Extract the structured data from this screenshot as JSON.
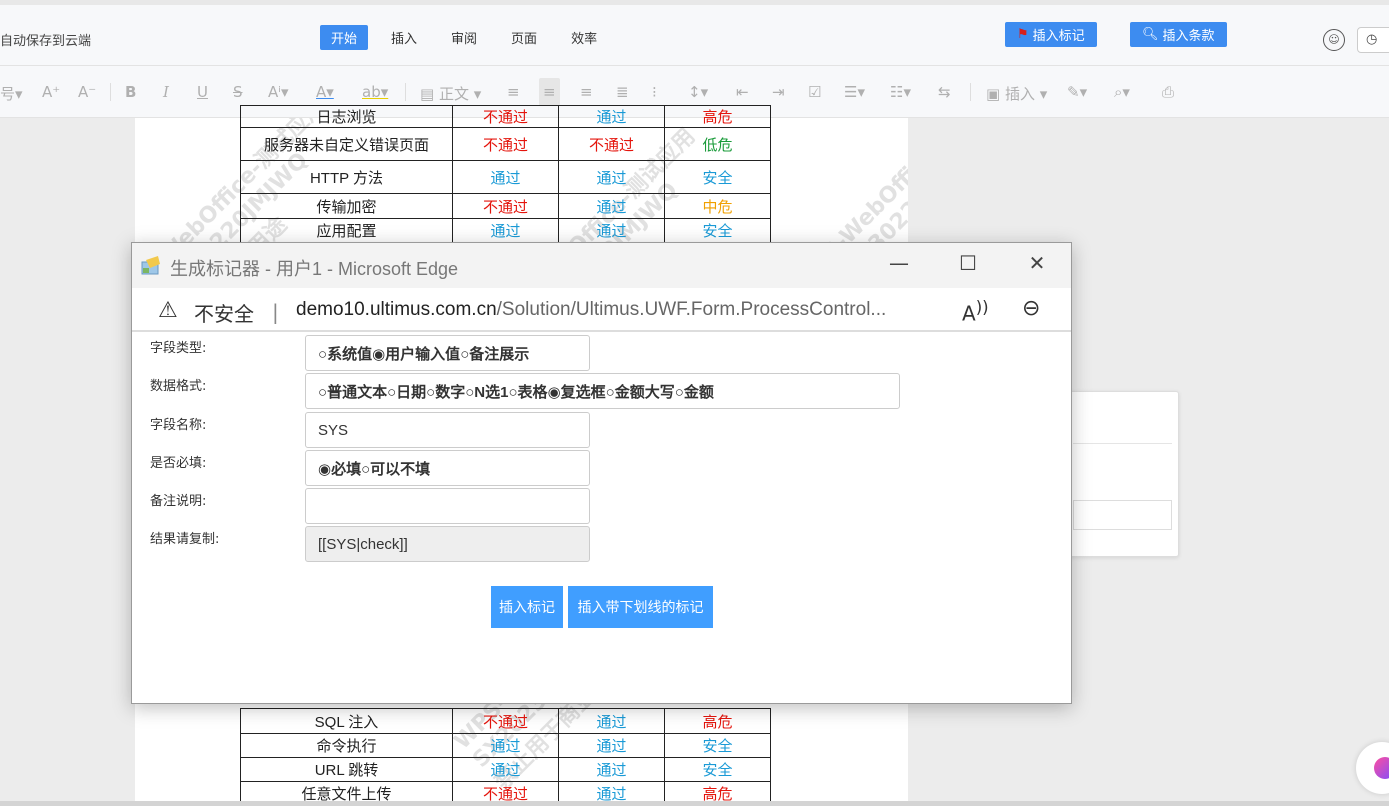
{
  "header": {
    "autosave": "自动保存到云端",
    "tabs": [
      {
        "label": "开始",
        "active": true
      },
      {
        "label": "插入",
        "active": false
      },
      {
        "label": "审阅",
        "active": false
      },
      {
        "label": "页面",
        "active": false
      },
      {
        "label": "效率",
        "active": false
      }
    ],
    "insert_mark_label": "插入标记",
    "insert_clause_label": "插入条款",
    "accent_color": "#3d8cf0"
  },
  "toolbar": {
    "style_label": "正文",
    "insert_label": "插入"
  },
  "watermark": {
    "line1": "WPS-WebOffice-测试应用",
    "line2": "SX20230220JMJWQ",
    "line3": "禁止用于商业用途"
  },
  "doc_table_top": [
    {
      "name": "日志浏览",
      "c1": "不通过",
      "c2": "通过",
      "c3": "高危",
      "k1": "red",
      "k2": "blue",
      "k3": "red"
    },
    {
      "name": "服务器未自定义错误页面",
      "c1": "不通过",
      "c2": "不通过",
      "c3": "低危",
      "k1": "red",
      "k2": "red",
      "k3": "green"
    },
    {
      "name": "HTTP 方法",
      "c1": "通过",
      "c2": "通过",
      "c3": "安全",
      "k1": "blue",
      "k2": "blue",
      "k3": "blue"
    },
    {
      "name": "传输加密",
      "c1": "不通过",
      "c2": "通过",
      "c3": "中危",
      "k1": "red",
      "k2": "blue",
      "k3": "orange"
    },
    {
      "name": "应用配置",
      "c1": "通过",
      "c2": "通过",
      "c3": "安全",
      "k1": "blue",
      "k2": "blue",
      "k3": "blue"
    }
  ],
  "doc_table_bottom": [
    {
      "name": "SQL 注入",
      "c1": "不通过",
      "c2": "通过",
      "c3": "高危",
      "k1": "red",
      "k2": "blue",
      "k3": "red"
    },
    {
      "name": "命令执行",
      "c1": "通过",
      "c2": "通过",
      "c3": "安全",
      "k1": "blue",
      "k2": "blue",
      "k3": "blue"
    },
    {
      "name": "URL 跳转",
      "c1": "通过",
      "c2": "通过",
      "c3": "安全",
      "k1": "blue",
      "k2": "blue",
      "k3": "blue"
    },
    {
      "name": "任意文件上传",
      "c1": "不通过",
      "c2": "通过",
      "c3": "高危",
      "k1": "red",
      "k2": "blue",
      "k3": "red"
    }
  ],
  "popup": {
    "window_title": "生成标记器 - 用户1 - Microsoft Edge",
    "insecure_label": "不安全",
    "url_host": "demo10.ultimus.com.cn",
    "url_path": "/Solution/Ultimus.UWF.Form.ProcessControl...",
    "fields": {
      "field_type_label": "字段类型:",
      "field_type_options": [
        "系统值",
        "用户输入值",
        "备注展示"
      ],
      "field_type_selected": 1,
      "data_format_label": "数据格式:",
      "data_format_options": [
        "普通文本",
        "日期",
        "数字",
        "N选1",
        "表格",
        "复选框",
        "金额大写",
        "金额"
      ],
      "data_format_selected": 5,
      "field_name_label": "字段名称:",
      "field_name_value": "SYS",
      "required_label": "是否必填:",
      "required_options": [
        "必填",
        "可以不填"
      ],
      "required_selected": 0,
      "remark_label": "备注说明:",
      "remark_value": "",
      "result_label": "结果请复制:",
      "result_value": "[[SYS|check]]"
    },
    "insert_mark_button": "插入标记",
    "insert_underline_button": "插入带下划线的标记"
  }
}
